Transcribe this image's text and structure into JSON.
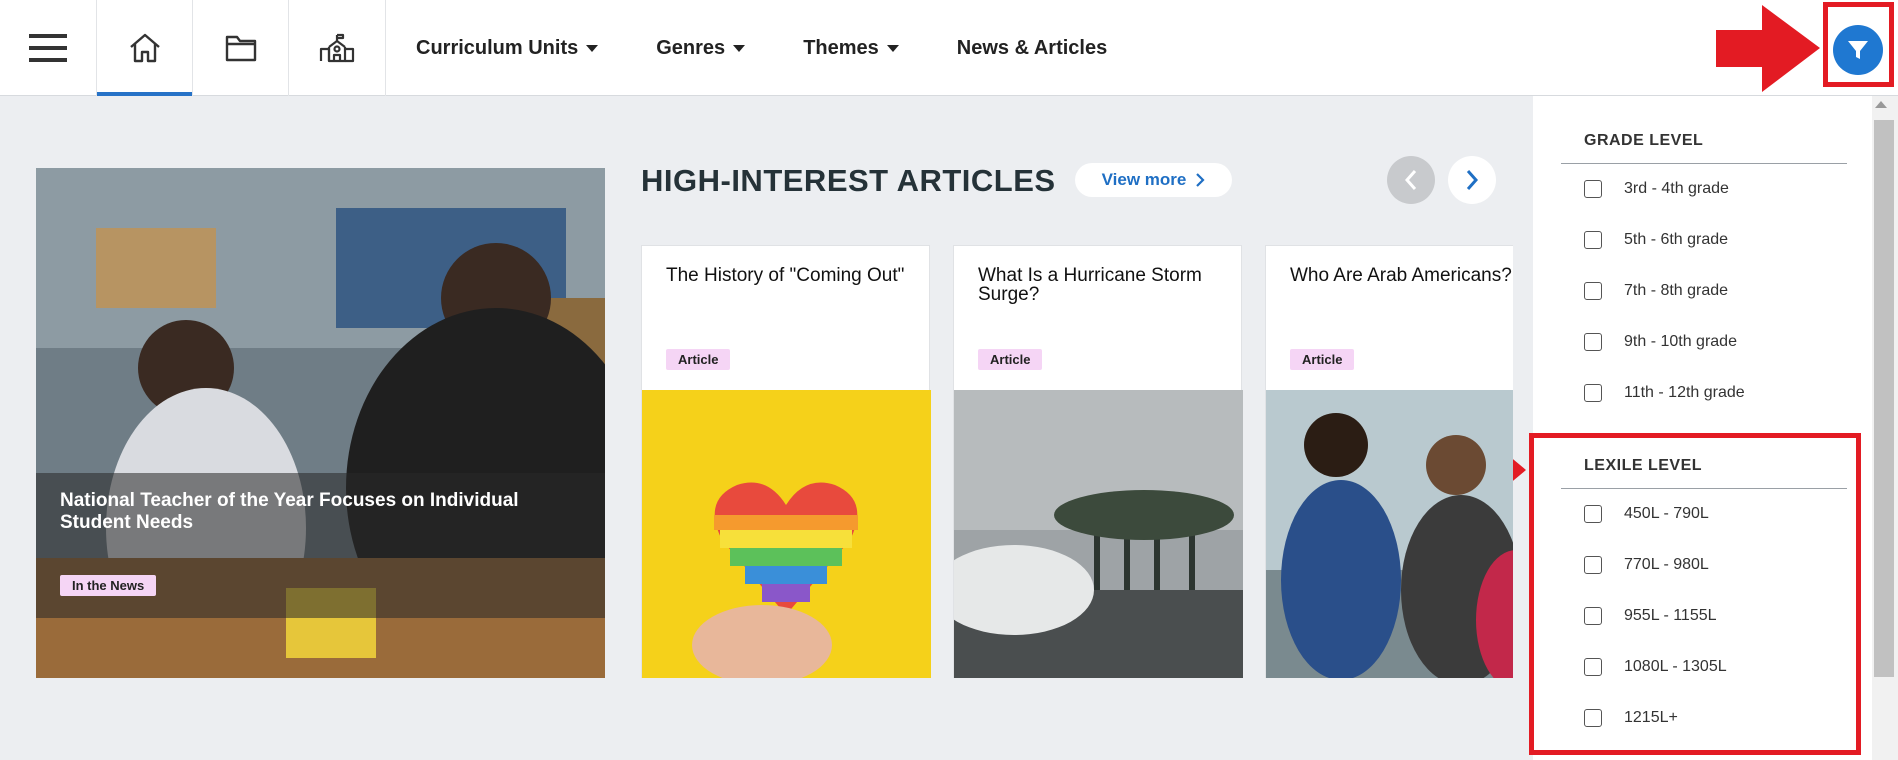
{
  "nav": {
    "links": [
      {
        "label": "Curriculum Units",
        "has_dropdown": true
      },
      {
        "label": "Genres",
        "has_dropdown": true
      },
      {
        "label": "Themes",
        "has_dropdown": true
      },
      {
        "label": "News & Articles",
        "has_dropdown": false
      }
    ],
    "icons": [
      "menu-icon",
      "home-icon",
      "folder-icon",
      "school-icon"
    ],
    "active": "home"
  },
  "featured": {
    "title": "National Teacher of the Year Focuses on Individual Student Needs",
    "badge": "In the News"
  },
  "articles": {
    "heading": "HIGH-INTEREST ARTICLES",
    "view_more": "View more",
    "cards": [
      {
        "title": "The History of \"Coming Out\"",
        "badge": "Article"
      },
      {
        "title": "What Is a Hurricane Storm Surge?",
        "badge": "Article"
      },
      {
        "title": "Who Are Arab Americans?",
        "badge": "Article"
      }
    ]
  },
  "filters": {
    "grade_level": {
      "title": "GRADE LEVEL",
      "options": [
        "3rd - 4th grade",
        "5th - 6th grade",
        "7th - 8th grade",
        "9th - 10th grade",
        "11th - 12th grade"
      ]
    },
    "lexile_level": {
      "title": "LEXILE LEVEL",
      "options": [
        "450L - 790L",
        "770L - 980L",
        "955L - 1155L",
        "1080L - 1305L",
        "1215L+"
      ]
    }
  },
  "colors": {
    "accent": "#1f78d1",
    "annotation": "#e31b23",
    "badge": "#f5d5f5",
    "background": "#eceef1"
  }
}
